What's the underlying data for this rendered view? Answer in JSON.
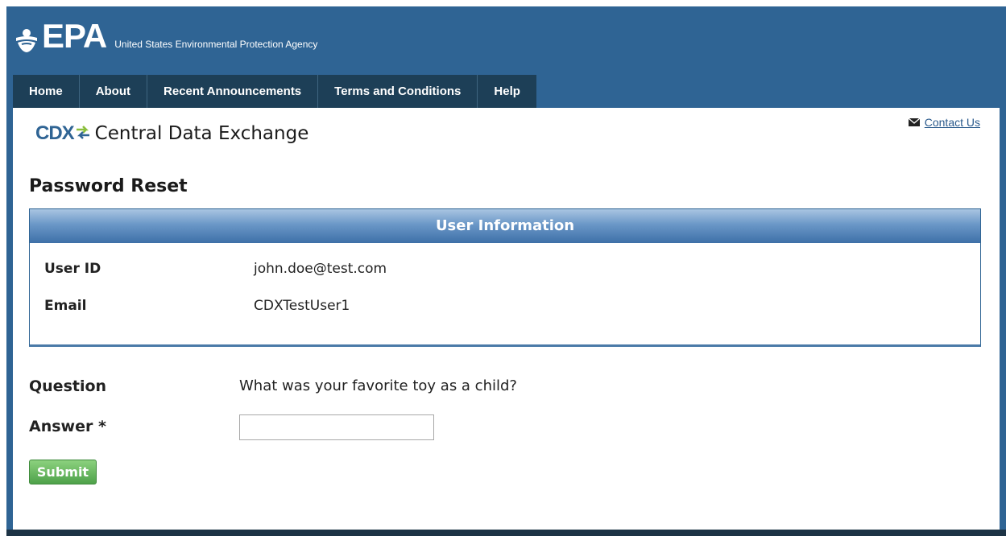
{
  "header": {
    "logo_text": "EPA",
    "agency_name": "United States Environmental Protection Agency"
  },
  "nav": {
    "items": [
      {
        "label": "Home"
      },
      {
        "label": "About"
      },
      {
        "label": "Recent Announcements"
      },
      {
        "label": "Terms and Conditions"
      },
      {
        "label": "Help"
      }
    ]
  },
  "app": {
    "logo_text": "CDX",
    "title": "Central Data Exchange",
    "contact_label": "Contact Us"
  },
  "page": {
    "title": "Password Reset"
  },
  "user_info": {
    "heading": "User Information",
    "user_id_label": "User ID",
    "user_id_value": "john.doe@test.com",
    "email_label": "Email",
    "email_value": "CDXTestUser1"
  },
  "form": {
    "question_label": "Question",
    "question_value": "What was your favorite toy as a child?",
    "answer_label": "Answer *",
    "answer_value": "",
    "submit_label": "Submit"
  },
  "colors": {
    "brand_blue": "#2f6494",
    "nav_dark": "#1d3f57",
    "submit_green": "#5cb85c"
  },
  "icons": [
    "epa-logo-icon",
    "cdx-arrows-icon",
    "envelope-icon"
  ]
}
